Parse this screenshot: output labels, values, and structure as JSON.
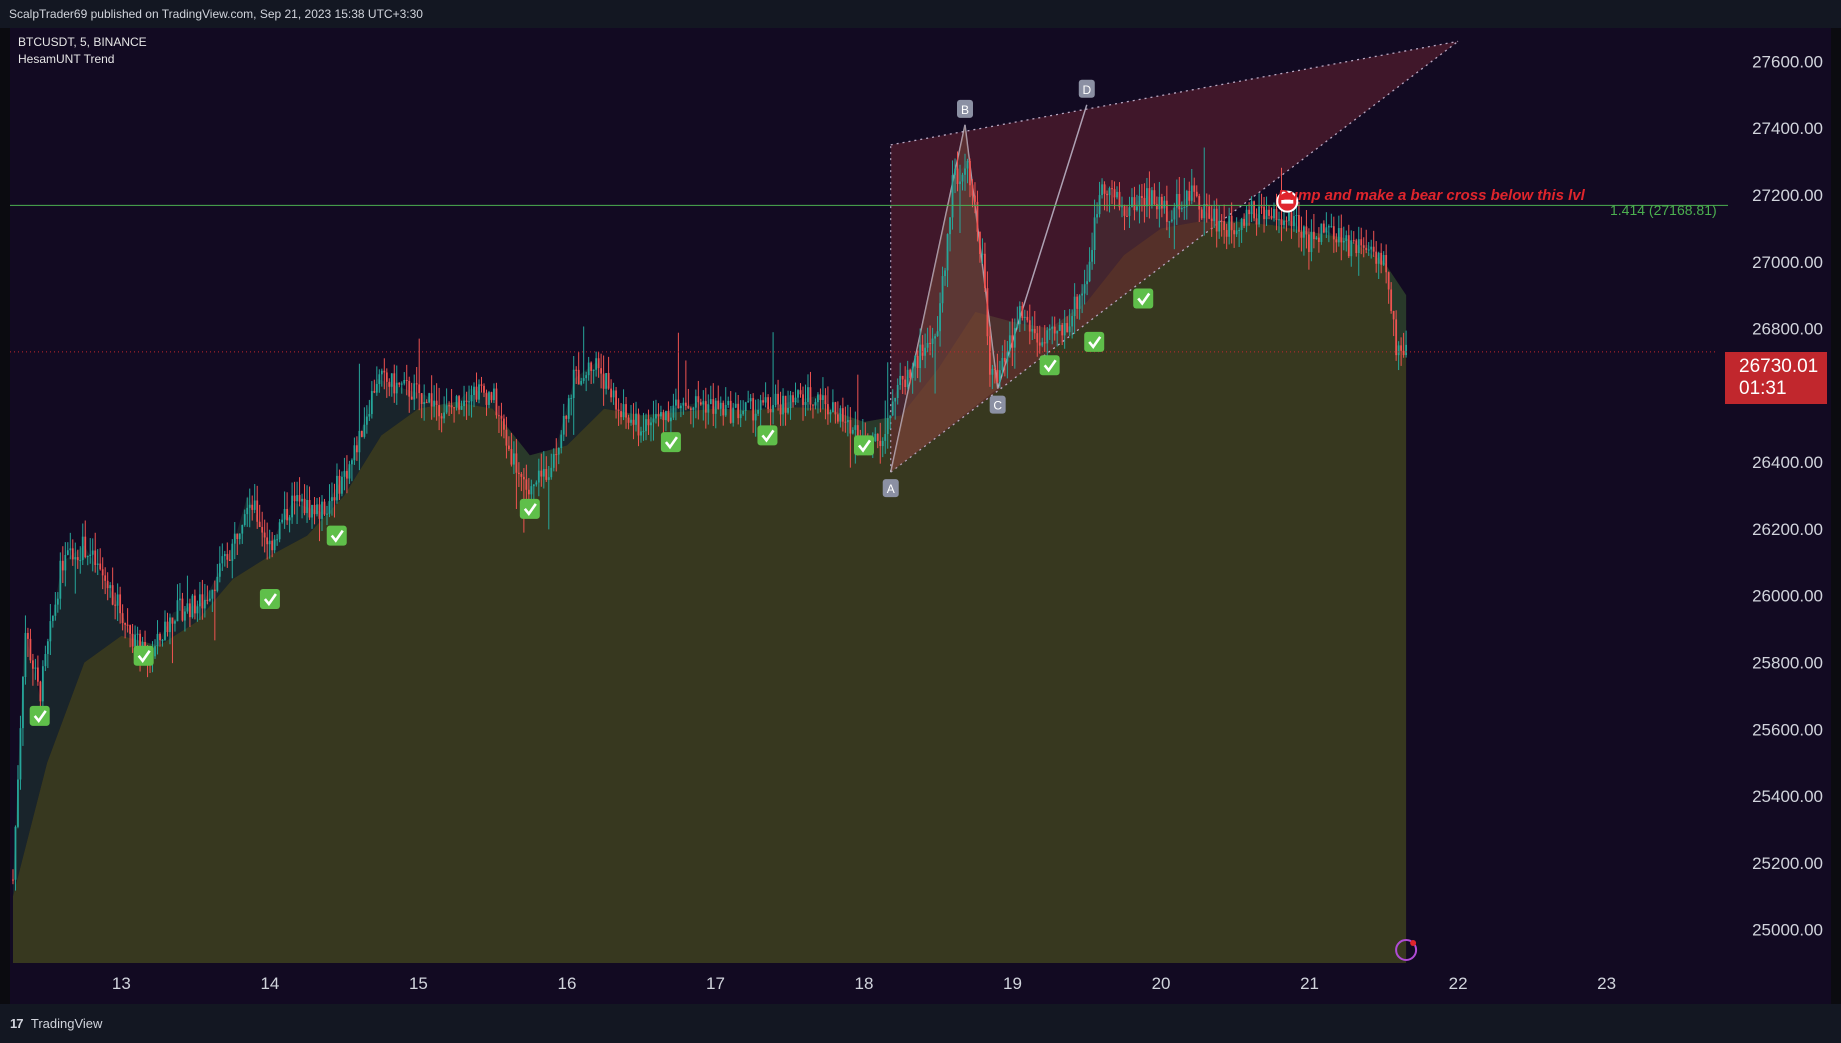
{
  "header": {
    "published": "ScalpTrader69 published on TradingView.com, Sep 21, 2023 15:38 UTC+3:30"
  },
  "legend": {
    "symbol": "BTCUSDT, 5, BINANCE",
    "indicator": "HesamUNT Trend"
  },
  "footer": {
    "logo_glyph": "17",
    "brand": "TradingView"
  },
  "price_badge": {
    "price": "26730.01",
    "countdown": "01:31"
  },
  "annotation": {
    "text": "Dump and make a bear cross below this lvl",
    "level_label": "1.414 (27168.81)"
  },
  "colors": {
    "background": "#120a22",
    "fill_green": "#37381f",
    "fill_red": "#7a2735",
    "candle_up": "#26a69a",
    "candle_down": "#ef5350",
    "level_line": "#4caf50",
    "badge": "#c1272d"
  },
  "chart_data": {
    "type": "candlestick",
    "symbol": "BTCUSDT",
    "timeframe": "5",
    "exchange": "BINANCE",
    "y_ticks": [
      25000,
      25200,
      25400,
      25600,
      25800,
      26000,
      26200,
      26400,
      26600,
      26800,
      27000,
      27200,
      27400,
      27600
    ],
    "y_tick_labels": [
      "25000.00",
      "25200.00",
      "25400.00",
      "25600.00",
      "25800.00",
      "26000.00",
      "26200.00",
      "26400.00",
      "26600.00",
      "26800.00",
      "27000.00",
      "27200.00",
      "27400.00",
      "27600.00"
    ],
    "ylim": [
      24900,
      27700
    ],
    "x_ticks": [
      13,
      14,
      15,
      16,
      17,
      18,
      19,
      20,
      21,
      22,
      23
    ],
    "x_tick_labels": [
      "13",
      "14",
      "15",
      "16",
      "17",
      "18",
      "19",
      "20",
      "21",
      "22",
      "23"
    ],
    "xlim": [
      12.25,
      23.75
    ],
    "last_x": 21.65,
    "price_path": [
      [
        12.27,
        25150
      ],
      [
        12.35,
        25900
      ],
      [
        12.45,
        25700
      ],
      [
        12.6,
        26100
      ],
      [
        12.75,
        26150
      ],
      [
        12.95,
        26000
      ],
      [
        13.05,
        25900
      ],
      [
        13.18,
        25800
      ],
      [
        13.35,
        25950
      ],
      [
        13.55,
        25980
      ],
      [
        13.75,
        26150
      ],
      [
        13.85,
        26300
      ],
      [
        14.0,
        26150
      ],
      [
        14.15,
        26280
      ],
      [
        14.35,
        26250
      ],
      [
        14.55,
        26400
      ],
      [
        14.72,
        26650
      ],
      [
        14.9,
        26620
      ],
      [
        15.05,
        26600
      ],
      [
        15.2,
        26550
      ],
      [
        15.35,
        26620
      ],
      [
        15.5,
        26600
      ],
      [
        15.6,
        26450
      ],
      [
        15.75,
        26300
      ],
      [
        15.9,
        26400
      ],
      [
        16.05,
        26650
      ],
      [
        16.2,
        26700
      ],
      [
        16.35,
        26550
      ],
      [
        16.5,
        26500
      ],
      [
        16.7,
        26560
      ],
      [
        16.9,
        26580
      ],
      [
        17.1,
        26550
      ],
      [
        17.3,
        26560
      ],
      [
        17.5,
        26580
      ],
      [
        17.7,
        26600
      ],
      [
        17.9,
        26500
      ],
      [
        18.1,
        26450
      ],
      [
        18.2,
        26600
      ],
      [
        18.35,
        26700
      ],
      [
        18.5,
        26800
      ],
      [
        18.6,
        27250
      ],
      [
        18.7,
        27300
      ],
      [
        18.8,
        27000
      ],
      [
        18.85,
        26650
      ],
      [
        18.95,
        26700
      ],
      [
        19.05,
        26850
      ],
      [
        19.2,
        26750
      ],
      [
        19.35,
        26800
      ],
      [
        19.5,
        26950
      ],
      [
        19.6,
        27250
      ],
      [
        19.75,
        27150
      ],
      [
        19.9,
        27200
      ],
      [
        20.05,
        27150
      ],
      [
        20.2,
        27200
      ],
      [
        20.3,
        27150
      ],
      [
        20.45,
        27100
      ],
      [
        20.6,
        27150
      ],
      [
        20.75,
        27130
      ],
      [
        20.9,
        27120
      ],
      [
        21.0,
        27050
      ],
      [
        21.1,
        27100
      ],
      [
        21.25,
        27050
      ],
      [
        21.4,
        27050
      ],
      [
        21.5,
        27000
      ],
      [
        21.58,
        26750
      ],
      [
        21.65,
        26730
      ]
    ],
    "ema_path": [
      [
        12.27,
        25100
      ],
      [
        12.5,
        25500
      ],
      [
        12.75,
        25800
      ],
      [
        13.0,
        25880
      ],
      [
        13.25,
        25850
      ],
      [
        13.5,
        25920
      ],
      [
        13.75,
        26050
      ],
      [
        14.0,
        26120
      ],
      [
        14.25,
        26180
      ],
      [
        14.5,
        26300
      ],
      [
        14.75,
        26480
      ],
      [
        15.0,
        26560
      ],
      [
        15.25,
        26580
      ],
      [
        15.5,
        26560
      ],
      [
        15.75,
        26420
      ],
      [
        16.0,
        26450
      ],
      [
        16.25,
        26560
      ],
      [
        16.5,
        26540
      ],
      [
        16.75,
        26550
      ],
      [
        17.0,
        26560
      ],
      [
        17.25,
        26555
      ],
      [
        17.5,
        26565
      ],
      [
        17.75,
        26560
      ],
      [
        18.0,
        26520
      ],
      [
        18.25,
        26540
      ],
      [
        18.5,
        26680
      ],
      [
        18.75,
        26850
      ],
      [
        19.0,
        26820
      ],
      [
        19.25,
        26800
      ],
      [
        19.5,
        26880
      ],
      [
        19.75,
        27020
      ],
      [
        20.0,
        27100
      ],
      [
        20.25,
        27120
      ],
      [
        20.5,
        27120
      ],
      [
        20.75,
        27110
      ],
      [
        21.0,
        27090
      ],
      [
        21.25,
        27070
      ],
      [
        21.5,
        27000
      ],
      [
        21.65,
        26900
      ]
    ],
    "signal_checkmarks": [
      [
        12.45,
        25640
      ],
      [
        13.15,
        25820
      ],
      [
        14.0,
        25990
      ],
      [
        14.45,
        26180
      ],
      [
        15.75,
        26260
      ],
      [
        16.7,
        26460
      ],
      [
        17.35,
        26480
      ],
      [
        18.0,
        26450
      ],
      [
        19.25,
        26690
      ],
      [
        19.55,
        26760
      ],
      [
        19.88,
        26890
      ]
    ],
    "exit_marker": [
      20.85,
      27180
    ],
    "harmonic_points": [
      {
        "label": "A",
        "x": 18.18,
        "y": 26370
      },
      {
        "label": "B",
        "x": 18.68,
        "y": 27410
      },
      {
        "label": "C",
        "x": 18.9,
        "y": 26620
      },
      {
        "label": "D",
        "x": 19.5,
        "y": 27470
      }
    ],
    "wedge": {
      "upper": [
        [
          18.18,
          27350
        ],
        [
          22.0,
          27660
        ]
      ],
      "lower": [
        [
          18.18,
          26370
        ],
        [
          22.0,
          27660
        ]
      ]
    },
    "level_line": 27168.81,
    "current_price_line": 26730.01
  }
}
